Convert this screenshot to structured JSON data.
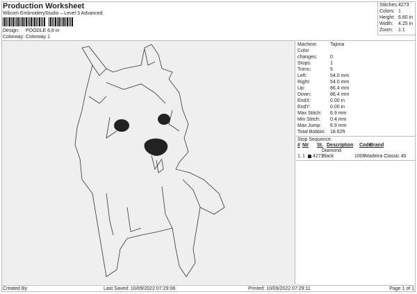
{
  "header": {
    "title": "Production Worksheet",
    "subtitle": "Wilcom EmbroideryStudio – Level 3 Advanced",
    "design_label": "Design:",
    "design_value": "POODLE 6,8 in",
    "colorway_label": "Colorway:",
    "colorway_value": "Colorway 1"
  },
  "stats": [
    {
      "k": "Stitches:",
      "v": "4273"
    },
    {
      "k": "Colors:",
      "v": "1"
    },
    {
      "k": "Height:",
      "v": "6.80 in"
    },
    {
      "k": "Width:",
      "v": "4.25 in"
    },
    {
      "k": "Zoom:",
      "v": "1:1"
    }
  ],
  "info": [
    {
      "k": "Machine:",
      "v": "Tajima"
    },
    {
      "k": "Color changes:",
      "v": "0"
    },
    {
      "k": "Stops:",
      "v": "1"
    },
    {
      "k": "Trims:",
      "v": "5"
    },
    {
      "k": "Left:",
      "v": "54.0 mm"
    },
    {
      "k": "Right:",
      "v": "54.0 mm"
    },
    {
      "k": "Up:",
      "v": "86.4 mm"
    },
    {
      "k": "Down:",
      "v": "86.4 mm"
    },
    {
      "k": "EndX:",
      "v": "0.00 in"
    },
    {
      "k": "EndY:",
      "v": "0.00 in"
    },
    {
      "k": "Max Stitch:",
      "v": "6.9 mm"
    },
    {
      "k": "Min Stitch:",
      "v": "0.4 mm"
    },
    {
      "k": "Max Jump:",
      "v": "6.9 mm"
    },
    {
      "k": "Total Bobbin:",
      "v": "18.62ft"
    }
  ],
  "stop_sequence": {
    "label": "Stop Sequence:",
    "headers": [
      "#",
      "N#",
      "St.",
      "Description",
      "Code",
      "Brand"
    ],
    "rows": [
      {
        "num": "1.",
        "n": "1",
        "color": "#222222",
        "st": "4271",
        "desc": "Diamond Black",
        "code": "1006",
        "brand": "Madeira Classic 40"
      }
    ]
  },
  "footer": {
    "created": "Created By:",
    "saved": "Last Saved: 10/09/2022 07:29:08",
    "printed": "Printed: 10/09/2022 07:29:11",
    "page": "Page 1 of 1"
  }
}
